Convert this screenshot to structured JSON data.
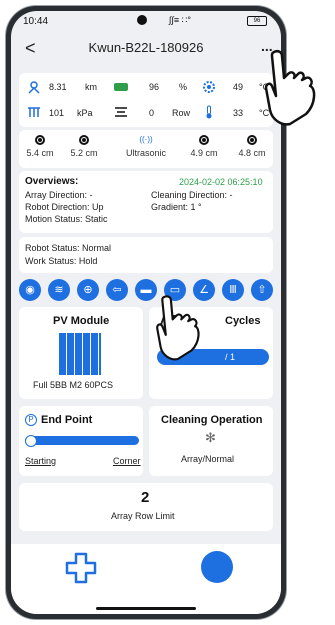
{
  "status_bar": {
    "time": "10:44",
    "signal_text": "∫∫≡ ∷°",
    "battery": "96"
  },
  "header": {
    "title": "Kwun-B22L-180926",
    "back_label": "<",
    "more_label": "..."
  },
  "metrics": {
    "row1": [
      {
        "icon": "robot-icon",
        "value": "8.31",
        "unit": "km"
      },
      {
        "icon": "battery-icon",
        "value": "96",
        "unit": "%"
      },
      {
        "icon": "gear-icon",
        "value": "49",
        "unit": "°C"
      }
    ],
    "row2": [
      {
        "icon": "pv-icon",
        "value": "101",
        "unit": "kPa"
      },
      {
        "icon": "rows-icon",
        "value": "0",
        "unit": "Row"
      },
      {
        "icon": "thermometer-icon",
        "value": "33",
        "unit": "°C"
      }
    ]
  },
  "sensors": [
    {
      "label": "5.4 cm"
    },
    {
      "label": "5.2 cm"
    },
    {
      "label": "Ultrasonic"
    },
    {
      "label": "4.9 cm"
    },
    {
      "label": "4.8 cm"
    }
  ],
  "overview": {
    "title": "Overviews:",
    "timestamp": "2024-02-02 06:25:10",
    "array_direction": "Array Direction:  -",
    "cleaning_direction": "Cleaning Direction:  -",
    "robot_direction": "Robot Direction: Up",
    "gradient": "Gradient:  1  °",
    "motion_status": "Motion Status: Static"
  },
  "robot_status": {
    "status": "Robot Status: Normal",
    "work": "Work Status: Hold"
  },
  "action_icons": [
    "power-icon",
    "wifi-icon",
    "gamepad-icon",
    "exit-icon",
    "brush-icon",
    "truck-icon",
    "broom-icon",
    "parking-icon",
    "upload-icon"
  ],
  "pv_module": {
    "title": "PV Module",
    "caption": "Full 5BB M2 60PCS"
  },
  "cycles": {
    "title": "Cycles",
    "value": "/ 1"
  },
  "end_point": {
    "title": "End Point",
    "start_label": "Starting",
    "end_label": "Corner"
  },
  "cleaning": {
    "title": "Cleaning Operation",
    "mode": "Array/Normal"
  },
  "array_row": {
    "value": "2",
    "label": "Array Row Limit"
  },
  "colors": {
    "accent": "#1e6fe0",
    "timestamp": "#2e9e4a"
  }
}
